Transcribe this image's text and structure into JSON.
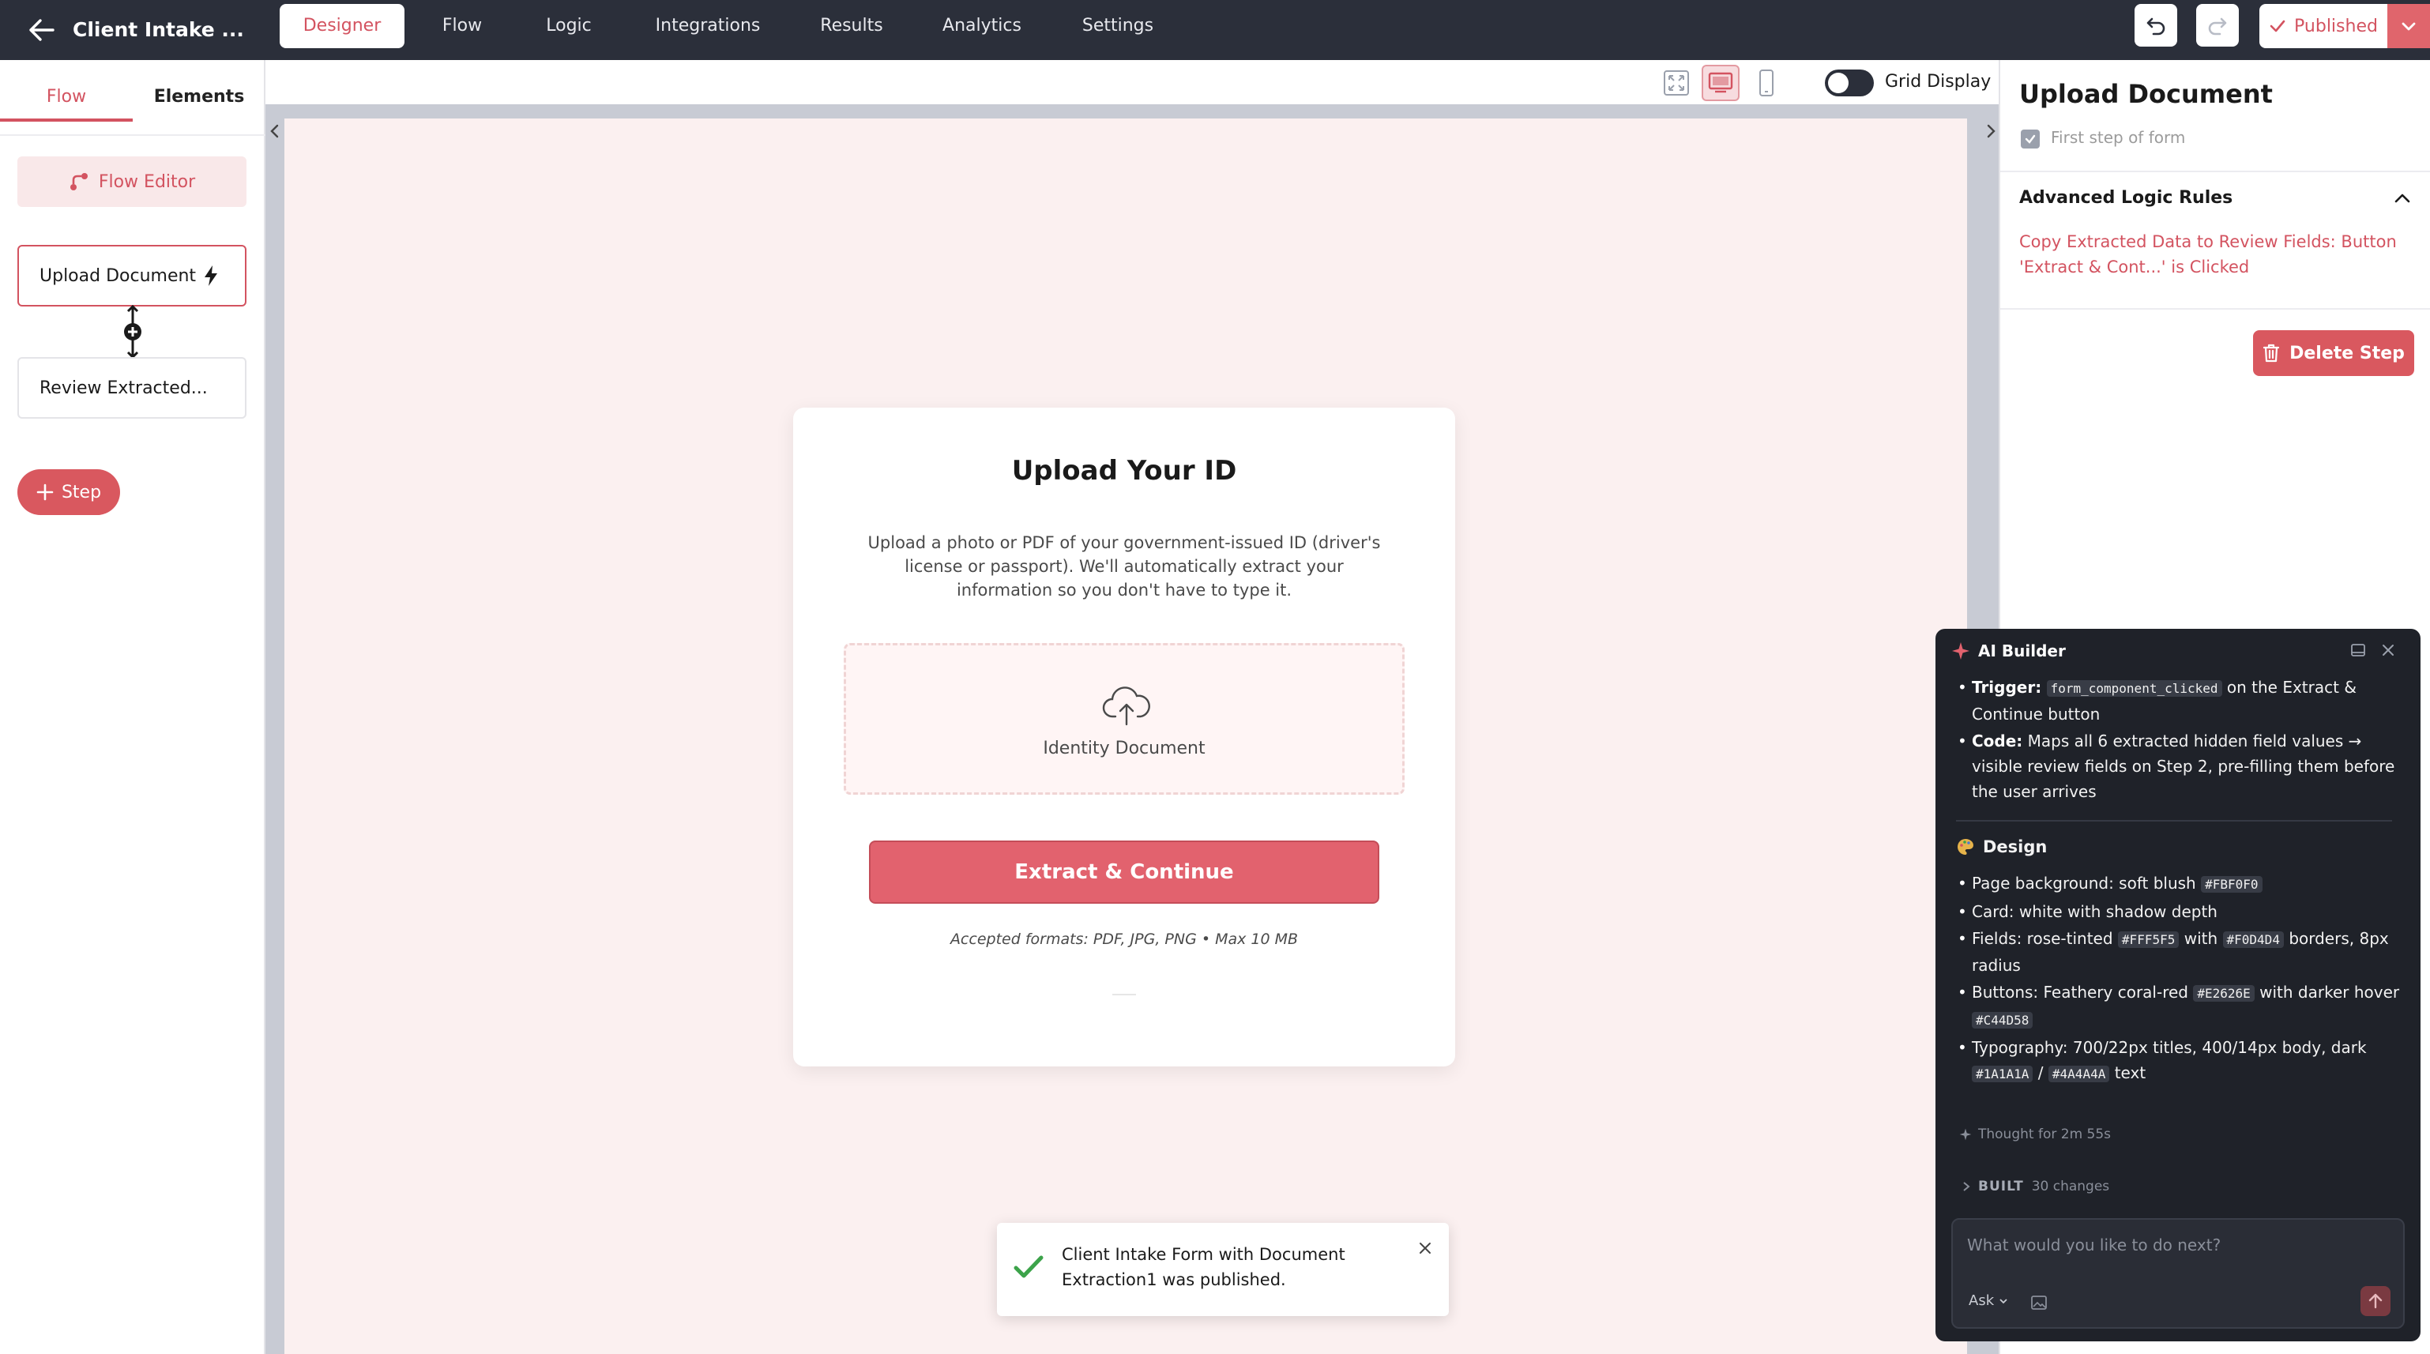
{
  "header": {
    "title": "Client Intake ...",
    "tabs": [
      {
        "label": "Designer",
        "active": true
      },
      {
        "label": "Flow"
      },
      {
        "label": "Logic"
      },
      {
        "label": "Integrations"
      },
      {
        "label": "Results"
      },
      {
        "label": "Analytics"
      },
      {
        "label": "Settings"
      }
    ],
    "publish_label": "Published"
  },
  "left_panel": {
    "tabs": [
      "Flow",
      "Elements"
    ],
    "flow_editor_label": "Flow Editor",
    "steps": [
      "Upload Document",
      "Review Extracted..."
    ],
    "add_step_label": "Step"
  },
  "toolbar": {
    "grid_display_label": "Grid Display",
    "grid_display_on": false
  },
  "form": {
    "title": "Upload Your ID",
    "description": "Upload a photo or PDF of your government-issued ID (driver's license or passport). We'll automatically extract your information so you don't have to type it.",
    "upload_label": "Identity Document",
    "button_label": "Extract & Continue",
    "formats": "Accepted formats: PDF, JPG, PNG • Max 10 MB"
  },
  "toast": {
    "message": "Client Intake Form with Document Extraction1 was published."
  },
  "right_panel": {
    "title": "Upload Document",
    "first_step_label": "First step of form",
    "section_title": "Advanced Logic Rules",
    "rule_text": "Copy Extracted Data to Review Fields: Button 'Extract & Cont...' is Clicked",
    "delete_label": "Delete Step"
  },
  "ai_builder": {
    "title": "AI Builder",
    "trigger_label": "Trigger:",
    "trigger_code": "form_component_clicked",
    "trigger_text": "on the Extract & Continue button",
    "code_label": "Code:",
    "code_text": "Maps all 6 extracted hidden field values → visible review fields on Step 2, pre-filling them before the user arrives",
    "design_title": "Design",
    "bg_text": "Page background: soft blush",
    "bg_code": "#FBF0F0",
    "card_text": "Card: white with shadow depth",
    "fields_text_1": "Fields: rose-tinted",
    "fields_code_1": "#FFF5F5",
    "fields_text_2": "with",
    "fields_code_2": "#F0D4D4",
    "fields_text_3": "borders, 8px radius",
    "buttons_text_1": "Buttons: Feathery coral-red",
    "buttons_code_1": "#E2626E",
    "buttons_text_2": "with darker hover",
    "buttons_code_2": "#C44D58",
    "typo_text_1": "Typography: 700/22px titles, 400/14px body, dark",
    "typo_code_1": "#1A1A1A",
    "typo_text_2": "/",
    "typo_code_2": "#4A4A4A",
    "typo_text_3": "text",
    "thought": "Thought for 2m 55s",
    "built_label": "BUILT",
    "built_count": "30 changes",
    "input_placeholder": "What would you like to do next?",
    "mode_label": "Ask"
  },
  "colors": {
    "accent": "#D35360",
    "topbar": "#2B2F3A",
    "canvas_bg": "#FBF0F0",
    "button": "#E2626E",
    "button_border": "#C44D58",
    "field_bg": "#FFF5F5",
    "field_border": "#F0D4D4",
    "ai_panel": "#1F2229",
    "success": "#3CA34A"
  }
}
